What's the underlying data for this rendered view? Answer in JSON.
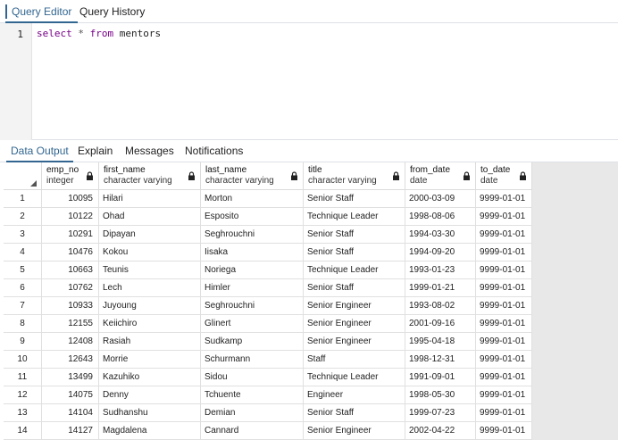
{
  "top_tabs": [
    {
      "label": "Query Editor",
      "active": true
    },
    {
      "label": "Query History",
      "active": false
    }
  ],
  "editor": {
    "line_numbers": [
      "1"
    ],
    "query": {
      "kw1": "select",
      "op": " * ",
      "kw2": "from",
      "rest": " mentors"
    }
  },
  "bottom_tabs": [
    {
      "label": "Data Output",
      "active": true
    },
    {
      "label": "Explain",
      "active": false
    },
    {
      "label": "Messages",
      "active": false
    },
    {
      "label": "Notifications",
      "active": false
    }
  ],
  "grid": {
    "columns": [
      {
        "name": "emp_no",
        "type": "integer"
      },
      {
        "name": "first_name",
        "type": "character varying"
      },
      {
        "name": "last_name",
        "type": "character varying"
      },
      {
        "name": "title",
        "type": "character varying"
      },
      {
        "name": "from_date",
        "type": "date"
      },
      {
        "name": "to_date",
        "type": "date"
      }
    ],
    "rows": [
      [
        "1",
        "10095",
        "Hilari",
        "Morton",
        "Senior Staff",
        "2000-03-09",
        "9999-01-01"
      ],
      [
        "2",
        "10122",
        "Ohad",
        "Esposito",
        "Technique Leader",
        "1998-08-06",
        "9999-01-01"
      ],
      [
        "3",
        "10291",
        "Dipayan",
        "Seghrouchni",
        "Senior Staff",
        "1994-03-30",
        "9999-01-01"
      ],
      [
        "4",
        "10476",
        "Kokou",
        "Iisaka",
        "Senior Staff",
        "1994-09-20",
        "9999-01-01"
      ],
      [
        "5",
        "10663",
        "Teunis",
        "Noriega",
        "Technique Leader",
        "1993-01-23",
        "9999-01-01"
      ],
      [
        "6",
        "10762",
        "Lech",
        "Himler",
        "Senior Staff",
        "1999-01-21",
        "9999-01-01"
      ],
      [
        "7",
        "10933",
        "Juyoung",
        "Seghrouchni",
        "Senior Engineer",
        "1993-08-02",
        "9999-01-01"
      ],
      [
        "8",
        "12155",
        "Keiichiro",
        "Glinert",
        "Senior Engineer",
        "2001-09-16",
        "9999-01-01"
      ],
      [
        "9",
        "12408",
        "Rasiah",
        "Sudkamp",
        "Senior Engineer",
        "1995-04-18",
        "9999-01-01"
      ],
      [
        "10",
        "12643",
        "Morrie",
        "Schurmann",
        "Staff",
        "1998-12-31",
        "9999-01-01"
      ],
      [
        "11",
        "13499",
        "Kazuhiko",
        "Sidou",
        "Technique Leader",
        "1991-09-01",
        "9999-01-01"
      ],
      [
        "12",
        "14075",
        "Denny",
        "Tchuente",
        "Engineer",
        "1998-05-30",
        "9999-01-01"
      ],
      [
        "13",
        "14104",
        "Sudhanshu",
        "Demian",
        "Senior Staff",
        "1999-07-23",
        "9999-01-01"
      ],
      [
        "14",
        "14127",
        "Magdalena",
        "Cannard",
        "Senior Engineer",
        "2002-04-22",
        "9999-01-01"
      ]
    ]
  },
  "icons": {
    "column_lock": "lock-icon",
    "select_all": "triangle-corner-icon"
  },
  "colors": {
    "accent": "#326690",
    "keyword": "#770088"
  }
}
